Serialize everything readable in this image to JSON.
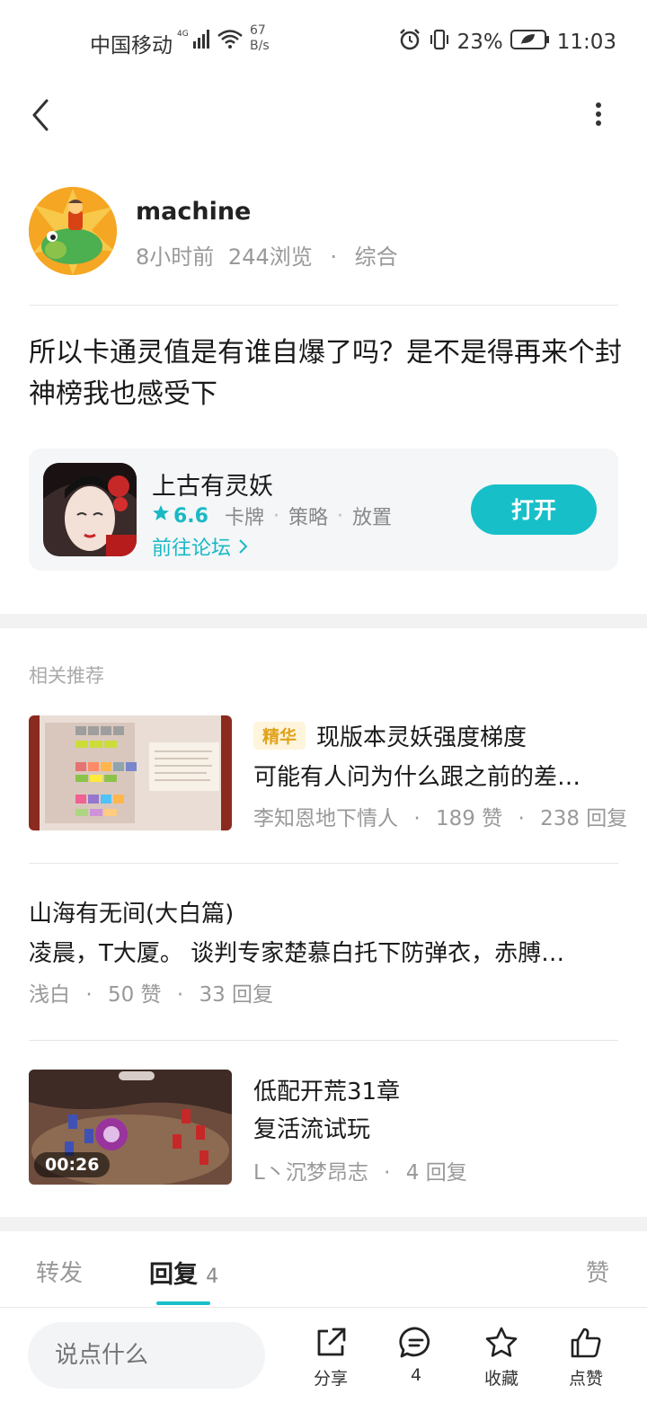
{
  "status_bar": {
    "carrier": "中国移动",
    "net_speed_value": "67",
    "net_speed_unit": "B/s",
    "battery": "23%",
    "time": "11:03"
  },
  "post": {
    "author": "machine",
    "time_ago": "8小时前",
    "views": "244浏览",
    "category": "综合",
    "content": "所以卡通灵值是有谁自爆了吗？是不是得再来个封神榜我也感受下"
  },
  "game_card": {
    "name": "上古有灵妖",
    "rating": "6.6",
    "tags": [
      "卡牌",
      "策略",
      "放置"
    ],
    "forum_link": "前往论坛",
    "open_button": "打开"
  },
  "related": {
    "label": "相关推荐",
    "items": [
      {
        "badge": "精华",
        "title": "现版本灵妖强度梯度",
        "subtitle": "可能有人问为什么跟之前的差…",
        "author": "李知恩地下情人",
        "likes": "189 赞",
        "replies": "238 回复"
      },
      {
        "title": "山海有无间(大白篇)",
        "subtitle": "凌晨，T大厦。 谈判专家楚慕白托下防弹衣，赤膊…",
        "author": "浅白",
        "likes": "50 赞",
        "replies": "33 回复"
      },
      {
        "title": "低配开荒31章",
        "subtitle": "复活流试玩",
        "author": "L丶沉梦昂志",
        "replies": "4 回复",
        "duration": "00:26"
      }
    ]
  },
  "tabs": {
    "forward": "转发",
    "reply": "回复",
    "reply_count": "4",
    "like": "赞"
  },
  "bottom_bar": {
    "input_placeholder": "说点什么",
    "share": "分享",
    "comments": "4",
    "favorite": "收藏",
    "like": "点赞"
  },
  "colors": {
    "accent": "#17bfc9",
    "badge_bg": "#fff4dc",
    "badge_text": "#e0a21a"
  }
}
